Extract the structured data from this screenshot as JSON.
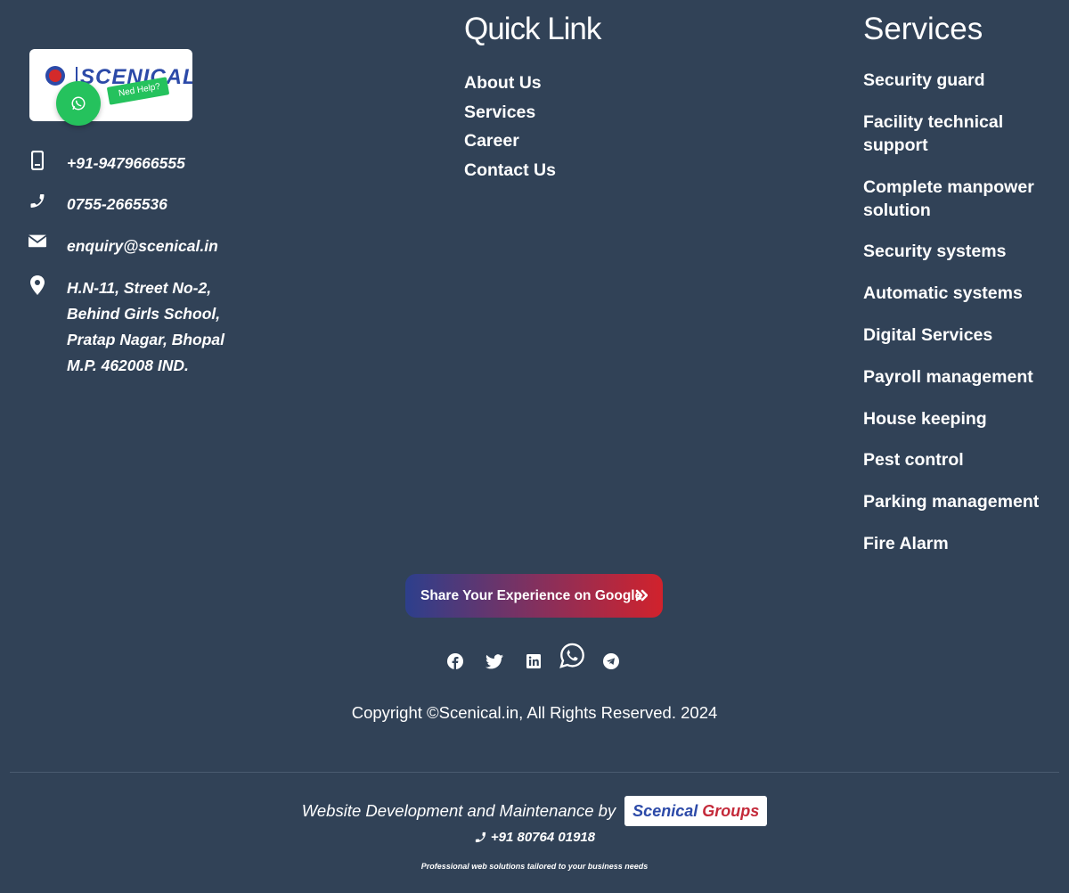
{
  "logo": {
    "text": "SCENICAL",
    "help_tag": "Ned Help?"
  },
  "contact": {
    "phone": "+91-9479666555",
    "landline": "0755-2665536",
    "email": "enquiry@scenical.in",
    "address": "H.N-11, Street No-2,\nBehind Girls School,\nPratap Nagar, Bhopal\nM.P. 462008 IND."
  },
  "quick_links": {
    "title": "Quick Link",
    "items": [
      "About Us",
      "Services",
      "Career",
      "Contact Us"
    ]
  },
  "services": {
    "title": "Services",
    "items": [
      "Security guard",
      "Facility technical support",
      "Complete manpower solution",
      "Security systems",
      "Automatic systems",
      "Digital Services",
      "Payroll management",
      "House keeping",
      "Pest control",
      "Parking management",
      "Fire Alarm"
    ]
  },
  "share_button": {
    "label": "Share Your Experience on Google"
  },
  "social": [
    "facebook-icon",
    "twitter-icon",
    "linkedin-icon",
    "whatsapp-icon",
    "telegram-icon"
  ],
  "copyright": "Copyright ©Scenical.in, All Rights Reserved. 2024",
  "developer": {
    "text": "Website Development and Maintenance by",
    "brand_part1": "Scenical",
    "brand_part2": "Groups",
    "phone": "+91 80764 01918",
    "tagline": "Professional web solutions tailored to your business needs"
  },
  "colors": {
    "background": "#314257",
    "whatsapp": "#25c25d",
    "brand_blue": "#2c4aa8",
    "brand_red": "#c42a3a"
  }
}
